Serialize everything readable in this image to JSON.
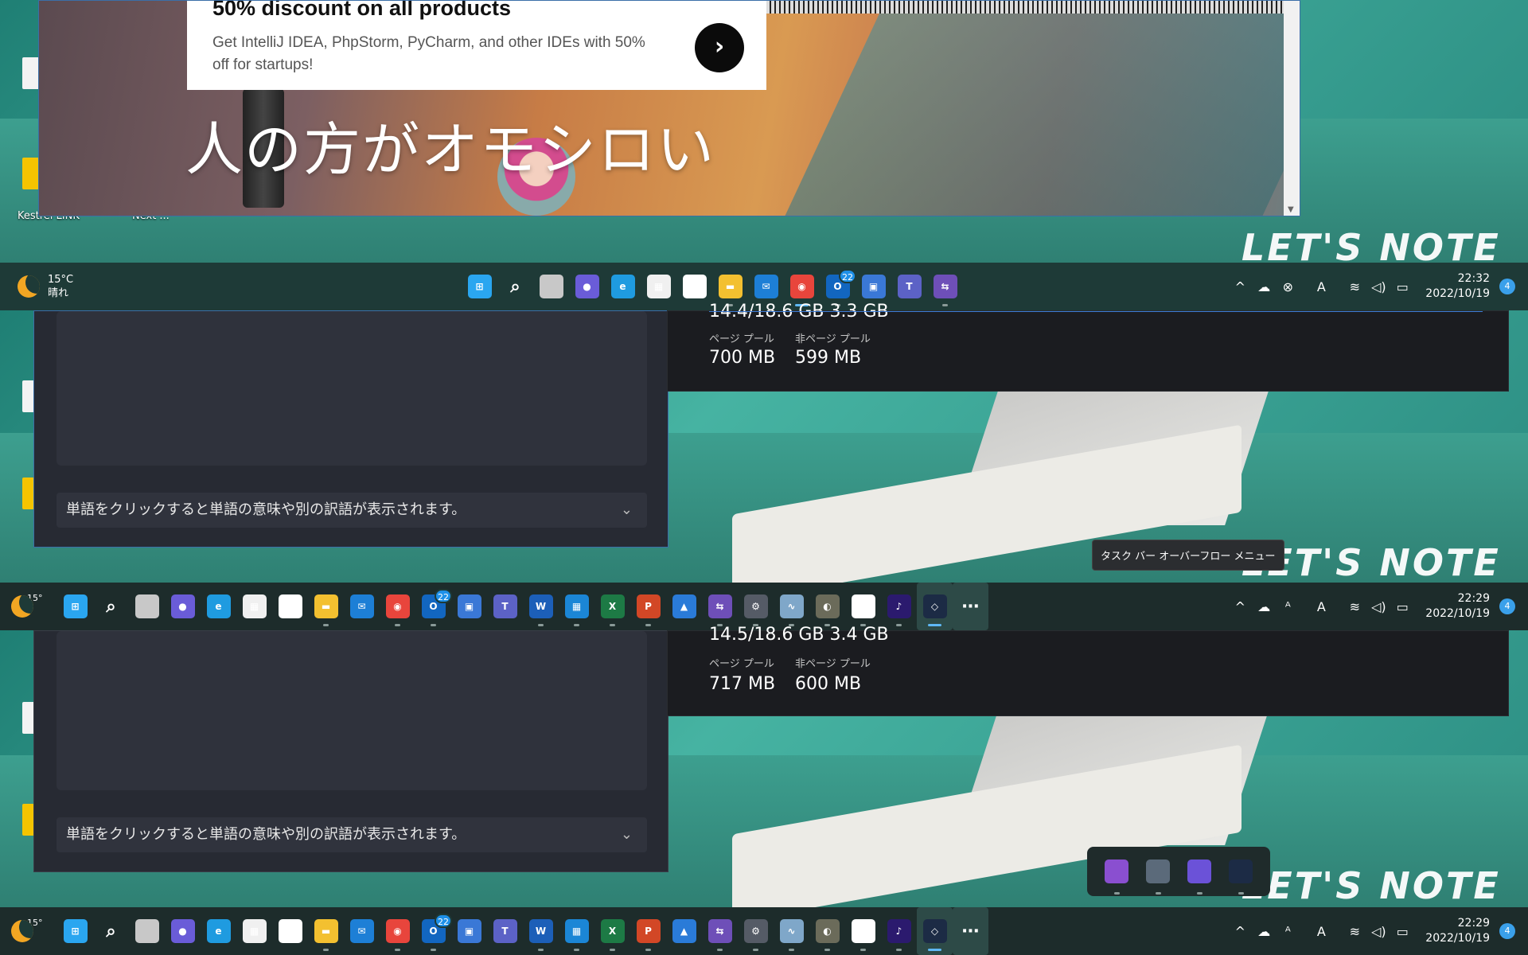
{
  "browser": {
    "promo_title": "50% discount on all products",
    "promo_text": "Get IntelliJ IDEA, PhpStorm, PyCharm, and other IDEs with 50% off for startups!",
    "promo_button": "›",
    "overlay_text": "人の方がオモシロい"
  },
  "desktop": {
    "captions": [
      "Kestrel LINK",
      "Next ..."
    ],
    "brand": "LET'S NOTE"
  },
  "taskbar_top": {
    "weather_temp": "15°C",
    "weather_cond": "晴れ",
    "mail_badge": "22",
    "time": "22:32",
    "date": "2022/10/19",
    "notifications": "4"
  },
  "taskbar_mid": {
    "weather_temp": "15°",
    "mail_badge": "22",
    "time": "22:29",
    "date": "2022/10/19",
    "notifications": "4",
    "tooltip": "タスク バー オーバーフロー メニュー"
  },
  "taskbar_bottom": {
    "weather_temp": "15°",
    "mail_badge": "22",
    "time": "22:29",
    "date": "2022/10/19",
    "notifications": "4"
  },
  "panel1": {
    "hint": "単語をクリックすると単語の意味や別の訳語が表示されます。"
  },
  "panel2": {
    "hint": "単語をクリックすると単語の意味や別の訳語が表示されます。"
  },
  "memory1": {
    "top_values": "14.4/18.6 GB    3.3 GB",
    "paged_label": "ページ プール",
    "nonpaged_label": "非ページ プール",
    "paged_value": "700 MB",
    "nonpaged_value": "599 MB"
  },
  "memory2": {
    "top_values": "14.5/18.6 GB    3.4 GB",
    "paged_label": "ページ プール",
    "nonpaged_label": "非ページ プール",
    "paged_value": "717 MB",
    "nonpaged_value": "600 MB"
  },
  "tray_glyphs": {
    "chevron": "^",
    "wifi": "≋",
    "volume": "◁)",
    "battery": "▭"
  },
  "taskbar_apps_top": [
    {
      "name": "start-icon",
      "color": "#2aa6f0",
      "glyph": "⊞",
      "dot": false
    },
    {
      "name": "search-icon",
      "color": "transparent",
      "glyph": "⌕",
      "dot": false
    },
    {
      "name": "task-view-icon",
      "color": "#c8c8c8",
      "glyph": "",
      "dot": false
    },
    {
      "name": "chat-icon",
      "color": "#6a5cd8",
      "glyph": "●",
      "dot": false
    },
    {
      "name": "edge-icon",
      "color": "#1f9be0",
      "glyph": "e",
      "dot": false
    },
    {
      "name": "store-icon",
      "color": "#f0f0f0",
      "glyph": "▦",
      "dot": false
    },
    {
      "name": "slack-icon",
      "color": "#ffffff",
      "glyph": "✱",
      "dot": false
    },
    {
      "name": "explorer-icon",
      "color": "#f3c030",
      "glyph": "▬",
      "dot": true
    },
    {
      "name": "mail-icon",
      "color": "#1d7fd6",
      "glyph": "✉",
      "dot": false
    },
    {
      "name": "chrome-icon",
      "color": "#e8453c",
      "glyph": "◉",
      "dot": true,
      "active": true
    },
    {
      "name": "outlook-icon",
      "color": "#1266c0",
      "glyph": "O",
      "dot": true,
      "badge": true
    },
    {
      "name": "remote-desktop-icon",
      "color": "#3a78d6",
      "glyph": "▣",
      "dot": false
    },
    {
      "name": "teams-icon",
      "color": "#5c62c6",
      "glyph": "T",
      "dot": false
    },
    {
      "name": "power-automate-icon",
      "color": "#6e4fb8",
      "glyph": "⇆",
      "dot": true
    }
  ],
  "taskbar_apps_full": [
    {
      "name": "start-icon",
      "color": "#2aa6f0",
      "glyph": "⊞",
      "dot": false
    },
    {
      "name": "search-icon",
      "color": "transparent",
      "glyph": "⌕",
      "dot": false
    },
    {
      "name": "task-view-icon",
      "color": "#c8c8c8",
      "glyph": "",
      "dot": false
    },
    {
      "name": "chat-icon",
      "color": "#6a5cd8",
      "glyph": "●",
      "dot": false
    },
    {
      "name": "edge-icon",
      "color": "#1f9be0",
      "glyph": "e",
      "dot": false
    },
    {
      "name": "store-icon",
      "color": "#f0f0f0",
      "glyph": "▦",
      "dot": false
    },
    {
      "name": "slack-icon",
      "color": "#ffffff",
      "glyph": "✱",
      "dot": false
    },
    {
      "name": "explorer-icon",
      "color": "#f3c030",
      "glyph": "▬",
      "dot": true
    },
    {
      "name": "mail-icon",
      "color": "#1d7fd6",
      "glyph": "✉",
      "dot": false
    },
    {
      "name": "chrome-icon",
      "color": "#e8453c",
      "glyph": "◉",
      "dot": true
    },
    {
      "name": "outlook-icon",
      "color": "#1266c0",
      "glyph": "O",
      "dot": true,
      "badge": true
    },
    {
      "name": "remote-desktop-icon",
      "color": "#3a78d6",
      "glyph": "▣",
      "dot": false
    },
    {
      "name": "teams-icon",
      "color": "#5c62c6",
      "glyph": "T",
      "dot": false
    },
    {
      "name": "word-icon",
      "color": "#1c5fb8",
      "glyph": "W",
      "dot": true
    },
    {
      "name": "calendar-icon",
      "color": "#1b86d6",
      "glyph": "▦",
      "dot": true
    },
    {
      "name": "excel-icon",
      "color": "#1d7a45",
      "glyph": "X",
      "dot": true
    },
    {
      "name": "powerpoint-icon",
      "color": "#d24726",
      "glyph": "P",
      "dot": true
    },
    {
      "name": "photos-icon",
      "color": "#2a7bd8",
      "glyph": "▲",
      "dot": false
    },
    {
      "name": "power-automate-icon",
      "color": "#6e4fb8",
      "glyph": "⇆",
      "dot": true
    },
    {
      "name": "settings-icon",
      "color": "#555b66",
      "glyph": "⚙",
      "dot": true
    },
    {
      "name": "resource-monitor-icon",
      "color": "#7fa7c9",
      "glyph": "∿",
      "dot": true
    },
    {
      "name": "gimp-icon",
      "color": "#6b6b5a",
      "glyph": "◐",
      "dot": true
    },
    {
      "name": "kestrel-icon",
      "color": "#ffffff",
      "glyph": "K",
      "dot": true
    },
    {
      "name": "amazon-music-icon",
      "color": "#2b1a6e",
      "glyph": "♪",
      "dot": true
    },
    {
      "name": "deepl-icon",
      "color": "#1c2b45",
      "glyph": "◇",
      "dot": true,
      "active": true,
      "hl": true
    },
    {
      "name": "more-icon",
      "color": "transparent",
      "glyph": "⋯",
      "dot": false,
      "hl": true
    }
  ],
  "overflow_apps": [
    {
      "name": "clapper-icon",
      "color": "#8a4fd0"
    },
    {
      "name": "calculator-icon",
      "color": "#5b6a7a"
    },
    {
      "name": "reader-icon",
      "color": "#6b52d8"
    },
    {
      "name": "deepl-icon",
      "color": "#1c2b45"
    }
  ]
}
